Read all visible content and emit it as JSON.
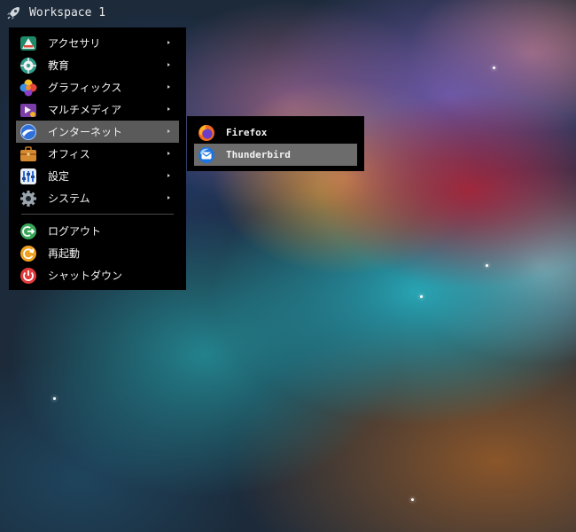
{
  "topbar": {
    "workspace_label": "Workspace 1",
    "icon": "rocket-icon"
  },
  "main_menu": {
    "items": [
      {
        "label": "アクセサリ",
        "icon": "accessories-icon",
        "submenu": true
      },
      {
        "label": "教育",
        "icon": "education-icon",
        "submenu": true
      },
      {
        "label": "グラフィックス",
        "icon": "graphics-icon",
        "submenu": true
      },
      {
        "label": "マルチメディア",
        "icon": "multimedia-icon",
        "submenu": true
      },
      {
        "label": "インターネット",
        "icon": "internet-icon",
        "submenu": true,
        "active": true
      },
      {
        "label": "オフィス",
        "icon": "office-icon",
        "submenu": true
      },
      {
        "label": "設定",
        "icon": "settings-icon",
        "submenu": true
      },
      {
        "label": "システム",
        "icon": "system-icon",
        "submenu": true
      }
    ],
    "session_items": [
      {
        "label": "ログアウト",
        "icon": "logout-icon"
      },
      {
        "label": "再起動",
        "icon": "reboot-icon"
      },
      {
        "label": "シャットダウン",
        "icon": "shutdown-icon"
      }
    ]
  },
  "internet_submenu": {
    "items": [
      {
        "label": "Firefox",
        "icon": "firefox-icon"
      },
      {
        "label": "Thunderbird",
        "icon": "thunderbird-icon",
        "highlighted": true
      }
    ]
  },
  "colors": {
    "menu_background": "#000000",
    "highlight": "#6c6c6c",
    "text": "#f2f2f2"
  }
}
